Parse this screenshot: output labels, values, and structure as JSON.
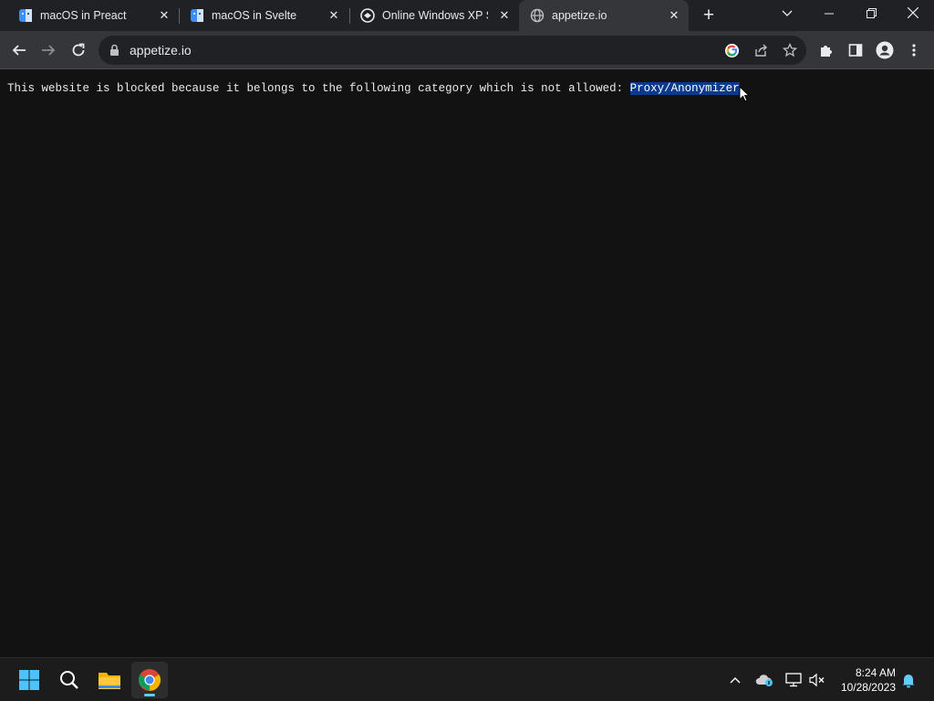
{
  "tabs": [
    {
      "title": "macOS in Preact",
      "favicon": "finder-icon"
    },
    {
      "title": "macOS in Svelte",
      "favicon": "finder-icon"
    },
    {
      "title": "Online Windows XP Si",
      "favicon": "xp-sim-icon"
    },
    {
      "title": "appetize.io",
      "favicon": "globe-icon",
      "active": true
    }
  ],
  "omnibox": {
    "url": "appetize.io"
  },
  "page": {
    "message": "This website is blocked because it belongs to the following category which is not allowed: ",
    "category": "Proxy/Anonymizer"
  },
  "taskbar": {
    "apps": [
      "start-icon",
      "search-icon",
      "file-explorer-icon",
      "chrome-icon"
    ],
    "time": "8:24 AM",
    "date": "10/28/2023"
  },
  "colors": {
    "tabstrip": "#202124",
    "toolbar": "#35363a",
    "page_bg": "#121212",
    "selection": "#0b3a8c",
    "taskbar": "#1c1c1c"
  }
}
